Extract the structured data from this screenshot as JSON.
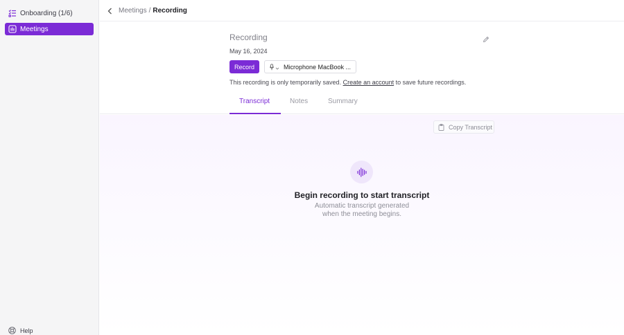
{
  "sidebar": {
    "items": [
      {
        "label": "Onboarding (1/6)",
        "icon": "checklist-icon"
      },
      {
        "label": "Meetings",
        "icon": "meetings-icon"
      }
    ],
    "help_label": "Help"
  },
  "breadcrumb": {
    "parent": "Meetings",
    "separator": "/",
    "current": "Recording"
  },
  "recording": {
    "title_placeholder": "Recording",
    "date": "May 16, 2024",
    "record_label": "Record",
    "microphone": "Microphone MacBook ...",
    "note_prefix": "This recording is only temporarily saved.",
    "note_link": "Create an account",
    "note_suffix": "to save future recordings."
  },
  "tabs": [
    {
      "label": "Transcript",
      "active": true
    },
    {
      "label": "Notes",
      "active": false
    },
    {
      "label": "Summary",
      "active": false
    }
  ],
  "transcript": {
    "copy_label": "Copy Transcript",
    "empty_title": "Begin recording to start transcript",
    "empty_line1": "Automatic transcript generated",
    "empty_line2": "when the meeting begins."
  },
  "colors": {
    "accent": "#7b2bd6",
    "sidebar_bg": "#f5f5f6"
  }
}
